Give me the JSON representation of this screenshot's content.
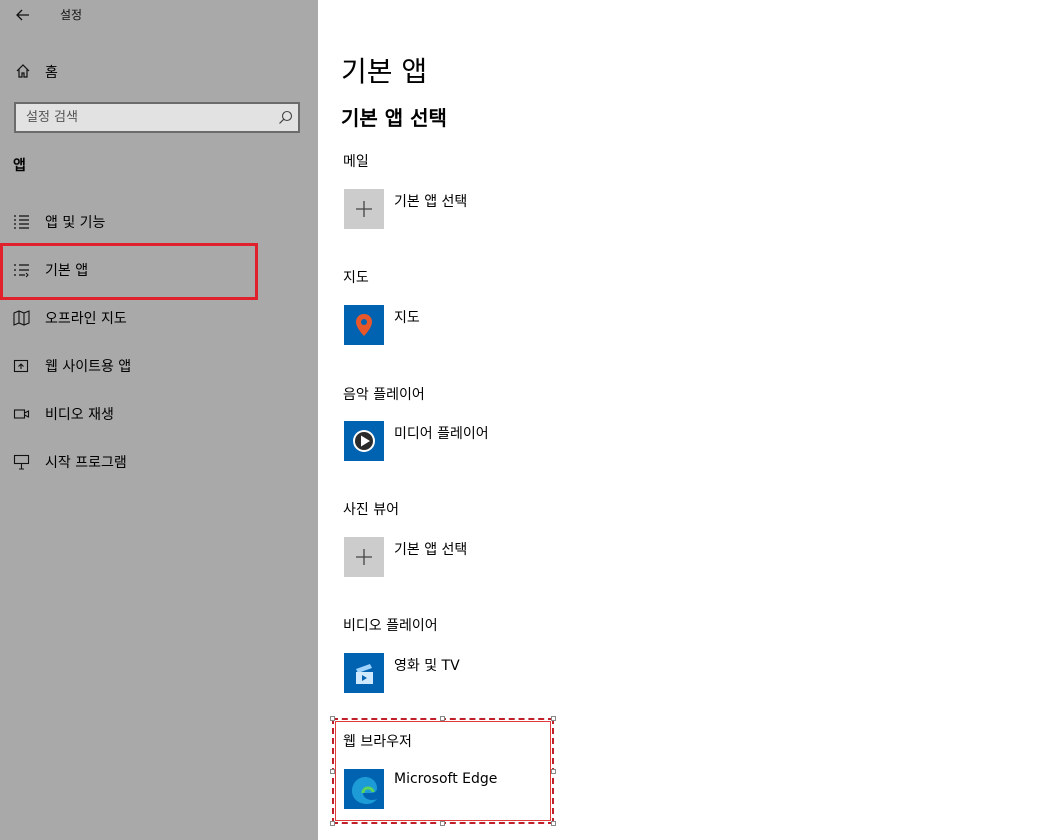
{
  "window": {
    "title": "설정"
  },
  "sidebar": {
    "home_label": "홈",
    "search_placeholder": "설정 검색",
    "section_label": "앱",
    "items": [
      {
        "label": "앱 및 기능",
        "icon": "apps-features-icon"
      },
      {
        "label": "기본 앱",
        "icon": "default-apps-icon",
        "active": true
      },
      {
        "label": "오프라인 지도",
        "icon": "offline-maps-icon"
      },
      {
        "label": "웹 사이트용 앱",
        "icon": "apps-for-websites-icon"
      },
      {
        "label": "비디오 재생",
        "icon": "video-playback-icon"
      },
      {
        "label": "시작 프로그램",
        "icon": "startup-icon"
      }
    ]
  },
  "main": {
    "title": "기본 앱",
    "subtitle": "기본 앱 선택",
    "categories": [
      {
        "label": "메일",
        "app": "기본 앱 선택",
        "icon": "plus-icon"
      },
      {
        "label": "지도",
        "app": "지도",
        "icon": "maps-icon"
      },
      {
        "label": "음악 플레이어",
        "app": "미디어 플레이어",
        "icon": "media-player-icon"
      },
      {
        "label": "사진 뷰어",
        "app": "기본 앱 선택",
        "icon": "plus-icon"
      },
      {
        "label": "비디오 플레이어",
        "app": "영화 및 TV",
        "icon": "movies-tv-icon"
      },
      {
        "label": "웹 브라우저",
        "app": "Microsoft Edge",
        "icon": "edge-icon"
      }
    ]
  },
  "colors": {
    "sidebar_bg": "#a9a9a9",
    "highlight": "#e0202a",
    "tile_blue": "#0063b1",
    "tile_gray": "#cccccc"
  }
}
